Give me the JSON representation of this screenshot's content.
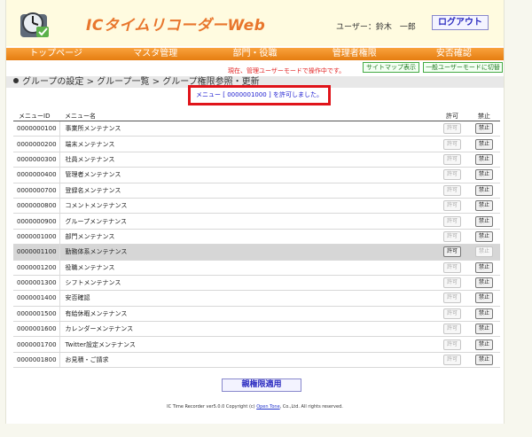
{
  "header": {
    "app_title": "ICタイムリコーダーWeb",
    "user_label": "ユーザー：鈴木　一郎",
    "logout_label": "ログアウト"
  },
  "nav": {
    "items": [
      {
        "label": "トップページ"
      },
      {
        "label": "マスタ管理"
      },
      {
        "label": "部門・役職"
      },
      {
        "label": "管理者権限"
      },
      {
        "label": "安否確認"
      }
    ]
  },
  "notice": {
    "mode_message": "現在、管理ユーザーモードで操作中です。",
    "sitemap_label": "サイトマップ表示",
    "switch_label": "一般ユーザーモードに切替"
  },
  "breadcrumb": {
    "text": "グループの設定 > グループ一覧 > グループ権限参照・更新"
  },
  "flash": {
    "message": "メニュー [ 0000001000 ] を許可しました。"
  },
  "table": {
    "headers": {
      "id": "メニューID",
      "name": "メニュー名",
      "allow": "許可",
      "deny": "禁止"
    },
    "allow_label": "許可",
    "deny_label": "禁止",
    "rows": [
      {
        "id": "0000000100",
        "name": "事業所メンテナンス",
        "allowed": false
      },
      {
        "id": "0000000200",
        "name": "端末メンテナンス",
        "allowed": false
      },
      {
        "id": "0000000300",
        "name": "社員メンテナンス",
        "allowed": false
      },
      {
        "id": "0000000400",
        "name": "管理者メンテナンス",
        "allowed": false
      },
      {
        "id": "0000000700",
        "name": "登録名メンテナンス",
        "allowed": false
      },
      {
        "id": "0000000800",
        "name": "コメントメンテナンス",
        "allowed": false
      },
      {
        "id": "0000000900",
        "name": "グループメンテナンス",
        "allowed": false
      },
      {
        "id": "0000001000",
        "name": "部門メンテナンス",
        "allowed": false
      },
      {
        "id": "0000001100",
        "name": "勤務体系メンテナンス",
        "allowed": true
      },
      {
        "id": "0000001200",
        "name": "役職メンテナンス",
        "allowed": false
      },
      {
        "id": "0000001300",
        "name": "シフトメンテナンス",
        "allowed": false
      },
      {
        "id": "0000001400",
        "name": "安否確認",
        "allowed": false
      },
      {
        "id": "0000001500",
        "name": "有給休暇メンテナンス",
        "allowed": false
      },
      {
        "id": "0000001600",
        "name": "カレンダーメンテナンス",
        "allowed": false
      },
      {
        "id": "0000001700",
        "name": "Twitter設定メンテナンス",
        "allowed": false
      },
      {
        "id": "0000001800",
        "name": "お見積・ご請求",
        "allowed": false
      }
    ]
  },
  "apply_label": "親権限適用",
  "footer": {
    "prefix": "IC Time Recorder ver5.0.0 Copyright (c)",
    "link": "Open Tone",
    "suffix": ", Co.,Ltd. All rights reserved."
  },
  "colors": {
    "accent_orange": "#e8762c",
    "nav_orange": "#f29a33",
    "flash_border": "#e0141a",
    "link_blue": "#2a2ac0"
  }
}
